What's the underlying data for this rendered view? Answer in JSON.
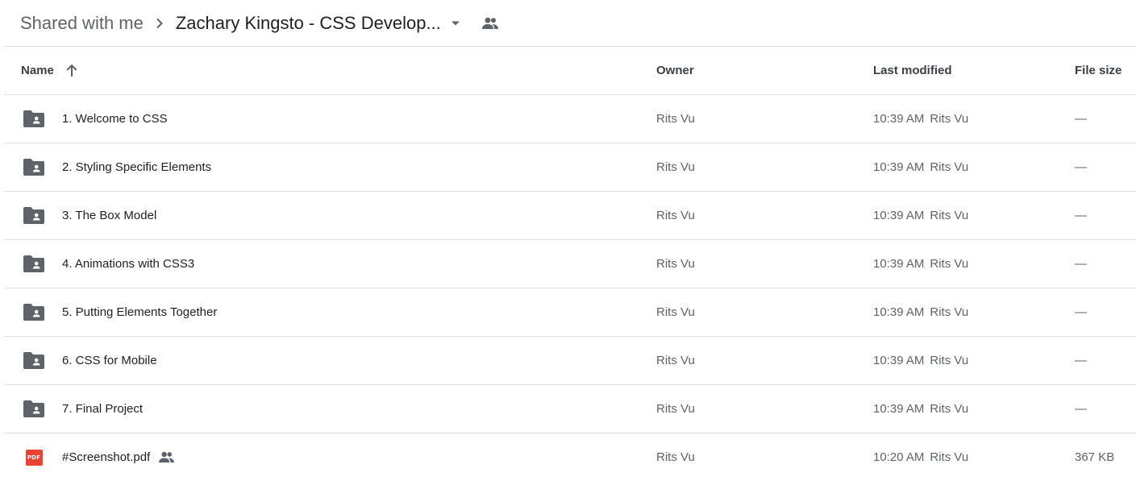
{
  "breadcrumb": {
    "root": "Shared with me",
    "current": "Zachary Kingsto - CSS Develop..."
  },
  "columns": {
    "name": "Name",
    "owner": "Owner",
    "last_modified": "Last modified",
    "file_size": "File size"
  },
  "sort": {
    "column": "name",
    "direction": "ascending"
  },
  "files": [
    {
      "type": "shared-folder",
      "name": "1. Welcome to CSS",
      "owner": "Rits Vu",
      "modified_time": "10:39 AM",
      "modified_by": "Rits Vu",
      "size": "—",
      "shared": false
    },
    {
      "type": "shared-folder",
      "name": "2. Styling Specific Elements",
      "owner": "Rits Vu",
      "modified_time": "10:39 AM",
      "modified_by": "Rits Vu",
      "size": "—",
      "shared": false
    },
    {
      "type": "shared-folder",
      "name": "3. The Box Model",
      "owner": "Rits Vu",
      "modified_time": "10:39 AM",
      "modified_by": "Rits Vu",
      "size": "—",
      "shared": false
    },
    {
      "type": "shared-folder",
      "name": "4. Animations with CSS3",
      "owner": "Rits Vu",
      "modified_time": "10:39 AM",
      "modified_by": "Rits Vu",
      "size": "—",
      "shared": false
    },
    {
      "type": "shared-folder",
      "name": "5. Putting Elements Together",
      "owner": "Rits Vu",
      "modified_time": "10:39 AM",
      "modified_by": "Rits Vu",
      "size": "—",
      "shared": false
    },
    {
      "type": "shared-folder",
      "name": "6. CSS for Mobile",
      "owner": "Rits Vu",
      "modified_time": "10:39 AM",
      "modified_by": "Rits Vu",
      "size": "—",
      "shared": false
    },
    {
      "type": "shared-folder",
      "name": "7. Final Project",
      "owner": "Rits Vu",
      "modified_time": "10:39 AM",
      "modified_by": "Rits Vu",
      "size": "—",
      "shared": false
    },
    {
      "type": "pdf",
      "name": "#Screenshot.pdf",
      "owner": "Rits Vu",
      "modified_time": "10:20 AM",
      "modified_by": "Rits Vu",
      "size": "367 KB",
      "shared": true,
      "badge": "PDF"
    }
  ],
  "colors": {
    "folder_icon": "#5f6368",
    "pdf_badge": "#ea4335",
    "divider": "#dadce0"
  }
}
